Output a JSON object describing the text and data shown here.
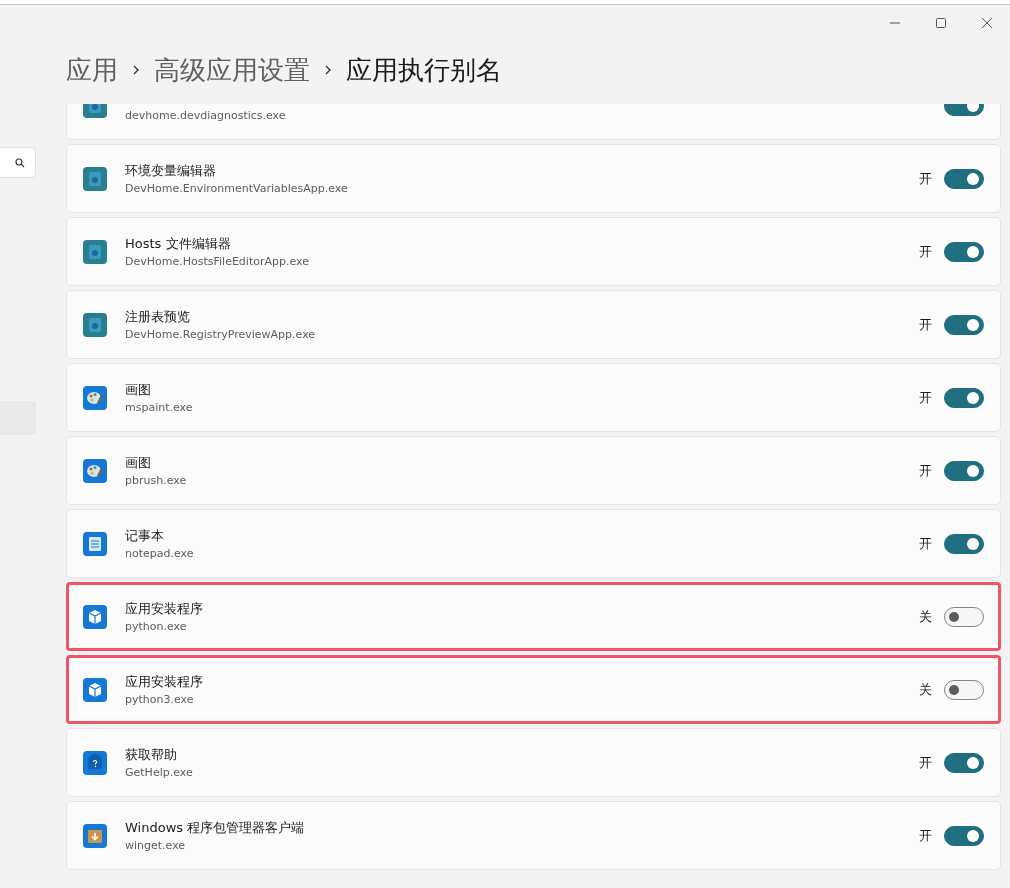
{
  "breadcrumb": [
    "应用",
    "高级应用设置",
    "应用执行别名"
  ],
  "aliases": [
    {
      "kind": "devhome",
      "subtitle": "devhome.devdiagnostics.exe",
      "on": true,
      "highlighted": false
    },
    {
      "kind": "devhome",
      "title": "环境变量编辑器",
      "subtitle": "DevHome.EnvironmentVariablesApp.exe",
      "state_label": "开",
      "on": true,
      "highlighted": false
    },
    {
      "kind": "devhome",
      "title": "Hosts 文件编辑器",
      "subtitle": "DevHome.HostsFileEditorApp.exe",
      "state_label": "开",
      "on": true,
      "highlighted": false
    },
    {
      "kind": "devhome",
      "title": "注册表预览",
      "subtitle": "DevHome.RegistryPreviewApp.exe",
      "state_label": "开",
      "on": true,
      "highlighted": false
    },
    {
      "kind": "paint",
      "title": "画图",
      "subtitle": "mspaint.exe",
      "state_label": "开",
      "on": true,
      "highlighted": false
    },
    {
      "kind": "paint",
      "title": "画图",
      "subtitle": "pbrush.exe",
      "state_label": "开",
      "on": true,
      "highlighted": false
    },
    {
      "kind": "notepad",
      "title": "记事本",
      "subtitle": "notepad.exe",
      "state_label": "开",
      "on": true,
      "highlighted": false
    },
    {
      "kind": "installer",
      "title": "应用安装程序",
      "subtitle": "python.exe",
      "state_label": "关",
      "on": false,
      "highlighted": true
    },
    {
      "kind": "installer",
      "title": "应用安装程序",
      "subtitle": "python3.exe",
      "state_label": "关",
      "on": false,
      "highlighted": true
    },
    {
      "kind": "help",
      "title": "获取帮助",
      "subtitle": "GetHelp.exe",
      "state_label": "开",
      "on": true,
      "highlighted": false
    },
    {
      "kind": "winget",
      "title": "Windows 程序包管理器客户端",
      "subtitle": "winget.exe",
      "state_label": "开",
      "on": true,
      "highlighted": false
    }
  ]
}
